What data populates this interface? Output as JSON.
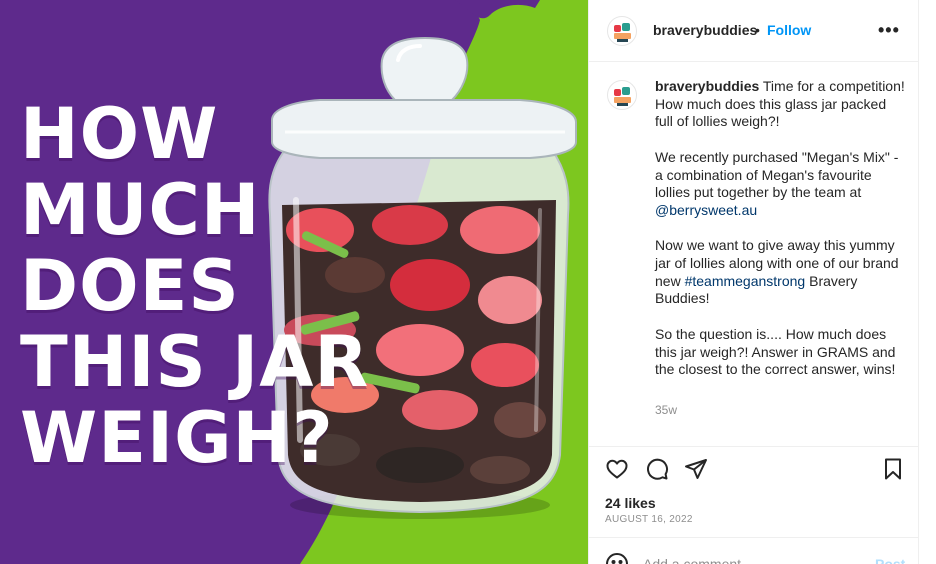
{
  "image": {
    "headline_lines": [
      "HOW",
      "MUCH",
      "DOES",
      "THIS JAR",
      "WEIGH?"
    ],
    "colors": {
      "purple": "#5e2a8c",
      "green": "#7dc71f"
    }
  },
  "header": {
    "username": "braverybuddies",
    "separator": "•",
    "follow_label": "Follow",
    "more_icon": "more-horizontal-icon"
  },
  "caption": {
    "username": "braverybuddies",
    "intro": " Time for a competition! How much does this glass jar packed full of lollies weigh?!",
    "para2_before": "We recently purchased \"Megan's Mix\" - a combination of Megan's favourite lollies put together by the team at ",
    "para2_mention": "@berrysweet.au",
    "para3_before": "Now we want to give away this yummy jar of lollies along with one of our brand new ",
    "para3_hashtag": "#teammeganstrong",
    "para3_after": " Bravery Buddies!",
    "para4": "So the question is.... How much does this jar weigh?! Answer in GRAMS and the closest to the correct answer, wins!",
    "time": "35w"
  },
  "actions": {
    "like_icon": "heart-icon",
    "comment_icon": "comment-icon",
    "share_icon": "send-icon",
    "save_icon": "bookmark-icon"
  },
  "stats": {
    "likes": "24 likes",
    "date": "AUGUST 16, 2022"
  },
  "comment_box": {
    "placeholder": "Add a comment...",
    "post_label": "Post",
    "emoji_icon": "emoji-icon"
  }
}
